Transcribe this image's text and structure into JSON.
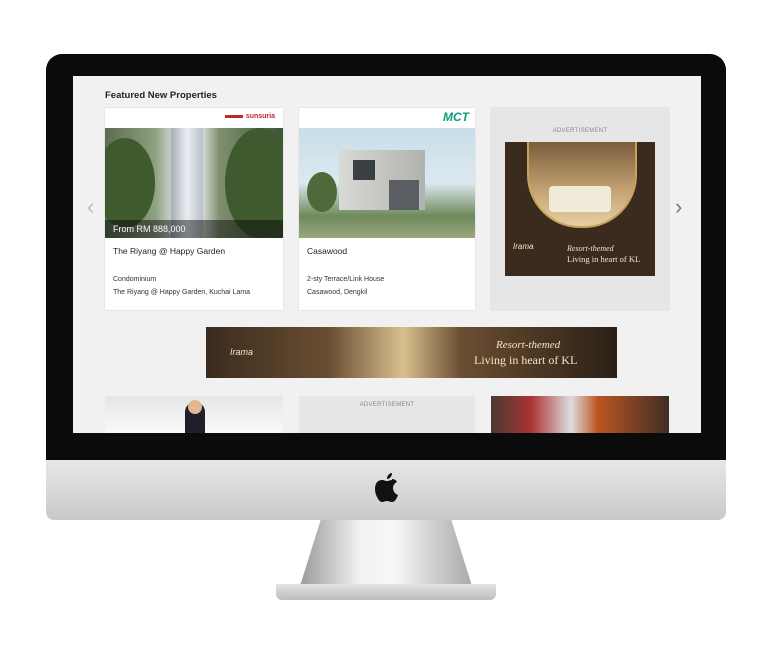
{
  "section_title": "Featured New Properties",
  "cards": [
    {
      "developer_logo": "sunsuria",
      "price": "From RM 888,000",
      "name": "The Riyang @ Happy Garden",
      "type": "Condominium",
      "location": "The Riyang @ Happy Garden, Kuchai Lama"
    },
    {
      "developer_logo": "MCT",
      "name": "Casawood",
      "type": "2-sty Terrace/Link House",
      "location": "Casawood, Dengkil"
    }
  ],
  "ad": {
    "label": "ADVERTISEMENT",
    "brand": "Irama",
    "headline1": "Resort-themed",
    "headline2": "Living in heart of KL"
  },
  "banner": {
    "brand": "Irama",
    "headline1": "Resort-themed",
    "headline2": "Living in heart of KL"
  },
  "bottom_row": {
    "ad_label": "ADVERTISEMENT"
  },
  "icons": {
    "prev": "chevron-left-icon",
    "next": "chevron-right-icon",
    "brand": "apple-logo-icon"
  },
  "colors": {
    "bezel": "#0b0b0b",
    "screen_bg": "#f1f1f1",
    "accent_red": "#c0262c",
    "accent_teal": "#0e9c7e",
    "ad_gold": "#f3e6c4"
  }
}
